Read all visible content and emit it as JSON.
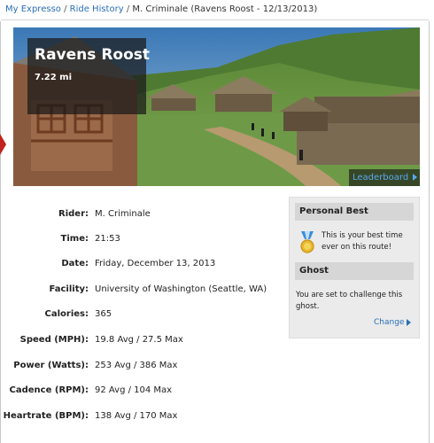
{
  "breadcrumb": {
    "home": "My Expresso",
    "separator": "/",
    "history": "Ride History",
    "current": "M. Criminale (Ravens Roost - 12/13/2013)"
  },
  "hero": {
    "route_name": "Ravens Roost",
    "distance": "7.22 mi",
    "leaderboard_label": "Leaderboard",
    "leaderboard_icon": "play-triangle-icon"
  },
  "stats": [
    {
      "label": "Rider:",
      "value": "M. Criminale"
    },
    {
      "label": "Time:",
      "value": "21:53"
    },
    {
      "label": "Date:",
      "value": "Friday, December 13, 2013"
    },
    {
      "label": "Facility:",
      "value": "University of Washington (Seattle, WA)"
    },
    {
      "label": "Calories:",
      "value": "365"
    },
    {
      "label": "Speed (MPH):",
      "value": "19.8 Avg / 27.5 Max"
    },
    {
      "label": "Power (Watts):",
      "value": "253 Avg / 386 Max"
    },
    {
      "label": "Cadence (RPM):",
      "value": "92 Avg / 104 Max"
    },
    {
      "label": "Heartrate (BPM):",
      "value": "138 Avg / 170 Max"
    }
  ],
  "sidebar": {
    "personal_best": {
      "title": "Personal Best",
      "icon": "medal-icon",
      "text": "This is your best time ever on this route!"
    },
    "ghost": {
      "title": "Ghost",
      "text": "You are set to challenge this ghost.",
      "change_label": "Change",
      "change_icon": "play-triangle-icon"
    }
  },
  "colors": {
    "link": "#2a6fb5",
    "leaderboard_link": "#5aa9ee",
    "panel_bg": "#ebebeb",
    "panel_header_bg": "#d6d6d6",
    "accent_red": "#c0231e"
  }
}
